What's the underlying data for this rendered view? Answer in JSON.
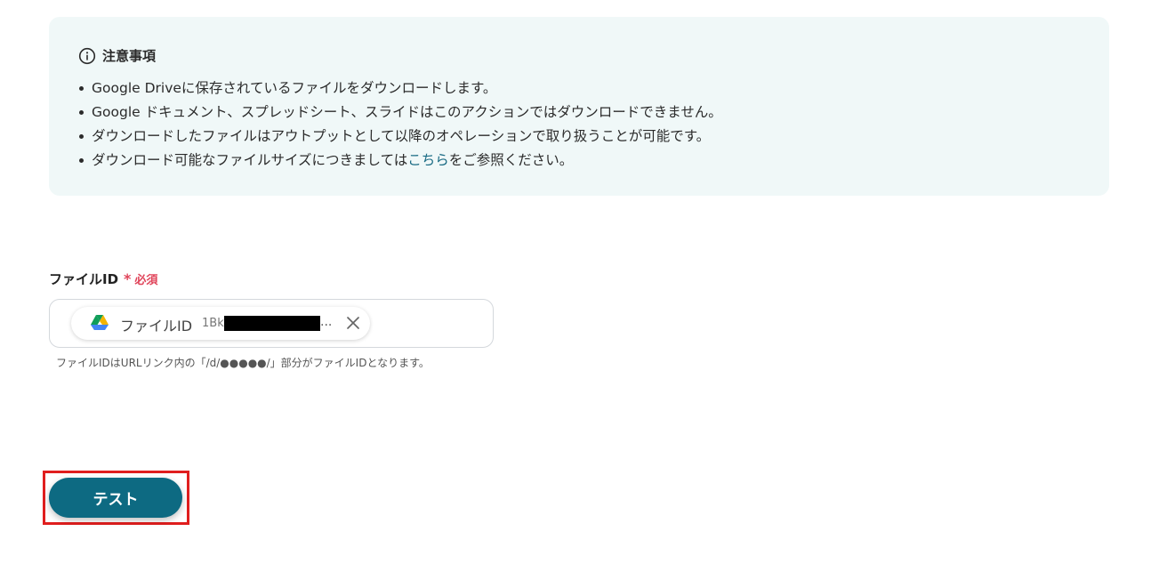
{
  "notice": {
    "icon": "info-icon",
    "title": "注意事項",
    "items": [
      "Google Driveに保存されているファイルをダウンロードします。",
      "Google ドキュメント、スプレッドシート、スライドはこのアクションではダウンロードできません。",
      "ダウンロードしたファイルはアウトプットとして以降のオペレーションで取り扱うことが可能です。"
    ],
    "item4_prefix": "ダウンロード可能なファイルサイズにつきましては",
    "item4_link": "こちら",
    "item4_suffix": "をご参照ください。"
  },
  "field": {
    "label": "ファイルID",
    "required_star": "*",
    "required_text": "必須",
    "chip": {
      "icon": "google-drive-icon",
      "label": "ファイルID",
      "value_prefix": "1Bk",
      "ellipsis": "...",
      "close_icon": "close-icon"
    },
    "hint": "ファイルIDはURLリンク内の「/d/●●●●●/」部分がファイルIDとなります。"
  },
  "actions": {
    "test_label": "テスト"
  },
  "colors": {
    "notice_bg": "#f0f8f8",
    "link": "#1a6b84",
    "required": "#e0445a",
    "primary_button": "#0d6a82",
    "highlight_border": "#e01e1e"
  }
}
